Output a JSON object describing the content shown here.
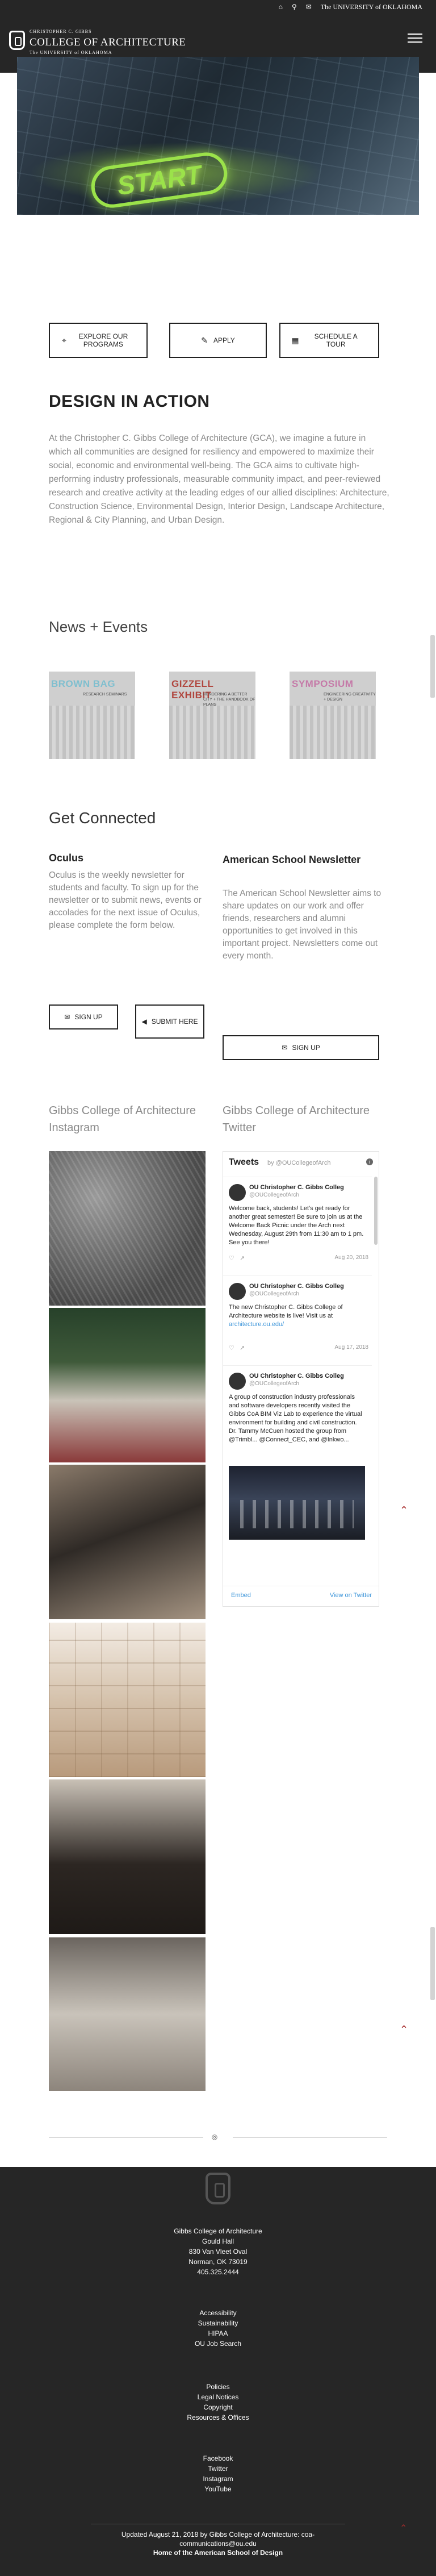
{
  "topbar": {
    "home_icon": "home-icon",
    "search_icon": "search-icon",
    "mail_icon": "mail-icon",
    "university_label": "The UNIVERSITY of OKLAHOMA"
  },
  "header": {
    "logo_small": "CHRISTOPHER C. GIBBS",
    "logo_big": "COLLEGE OF ARCHITECTURE",
    "logo_sub": "The UNIVERSITY of OKLAHOMA",
    "menu_icon": "hamburger-menu-icon"
  },
  "hero": {
    "start_text": "START"
  },
  "cta": {
    "explore": "EXPLORE OUR PROGRAMS",
    "apply": "APPLY",
    "tour": "SCHEDULE A TOUR"
  },
  "design": {
    "title": "DESIGN IN ACTION",
    "body": "At the Christopher C. Gibbs College of Architecture (GCA), we imagine a future in which all communities are designed for resiliency and empowered to maximize their social, economic and environmental well-being. The GCA aims to cultivate high-performing industry professionals, measurable community impact, and peer-reviewed research and creative activity at the leading edges of our allied disciplines: Architecture, Construction Science, Environmental Design, Interior Design, Landscape Architecture, Regional & City Planning, and Urban Design."
  },
  "news": {
    "title": "News + Events",
    "cards": [
      {
        "title": "BROWN BAG",
        "subtitle": "RESEARCH SEMINARS"
      },
      {
        "title": "GIZZELL EXHIBIT",
        "subtitle": "RENDERING A BETTER CITY + THE HANDBOOK OF PLANS"
      },
      {
        "title": "SYMPOSIUM",
        "subtitle": "ENGINEERING CREATIVITY + DESIGN"
      }
    ]
  },
  "connect": {
    "title": "Get Connected",
    "oculus_title": "Oculus",
    "oculus_body": "Oculus is the weekly newsletter for students and faculty. To sign up for the newsletter or to submit news, events or accolades for the next issue of Oculus, please complete the form below.",
    "oculus_signup": "SIGN UP",
    "oculus_submit": "SUBMIT HERE",
    "asn_title": "American School Newsletter",
    "asn_body": "The American School Newsletter aims to share updates on our work and offer friends, researchers and alumni opportunities to get involved in this important project. Newsletters come out every month.",
    "asn_signup": "SIGN UP"
  },
  "social": {
    "instagram_title": "Gibbs College of Architecture Instagram",
    "twitter_title": "Gibbs College of Architecture Twitter",
    "tweets_label": "Tweets",
    "tweets_by": "by @OUCollegeofArch",
    "tweets": [
      {
        "name": "OU Christopher C. Gibbs Colleg",
        "handle": "@OUCollegeofArch",
        "text": "Welcome back, students! Let's get ready for another great semester! Be sure to join us at the Welcome Back Picnic under the Arch next Wednesday, August 29th from 11:30 am to 1 pm. See you there!",
        "date": "Aug 20, 2018"
      },
      {
        "name": "OU Christopher C. Gibbs Colleg",
        "handle": "@OUCollegeofArch",
        "text": "The new Christopher C. Gibbs College of Architecture website is live! Visit us at",
        "link": "architecture.ou.edu/",
        "date": "Aug 17, 2018"
      },
      {
        "name": "OU Christopher C. Gibbs Colleg",
        "handle": "@OUCollegeofArch",
        "text": "A group of construction industry professionals and software developers recently visited the Gibbs CoA BIM Viz Lab to experience the virtual environment for building and civil construction. Dr. Tammy McCuen hosted the group from @Trimbl... @Connect_CEC, and @Inkwo..."
      }
    ],
    "embed_label": "Embed",
    "view_label": "View on Twitter"
  },
  "footer": {
    "address": [
      "Gibbs College of Architecture",
      "Gould Hall",
      "830 Van Vleet Oval",
      "Norman, OK 73019",
      "405.325.2444"
    ],
    "links1": [
      "Accessibility",
      "Sustainability",
      "HIPAA",
      "OU Job Search"
    ],
    "links2": [
      "Policies",
      "Legal Notices",
      "Copyright",
      "Resources & Offices"
    ],
    "links3": [
      "Facebook",
      "Twitter",
      "Instagram",
      "YouTube"
    ],
    "updated": "Updated August 21, 2018 by Gibbs College of Architecture: coa-communications@ou.edu",
    "home_link": "Home of the American School of Design"
  }
}
